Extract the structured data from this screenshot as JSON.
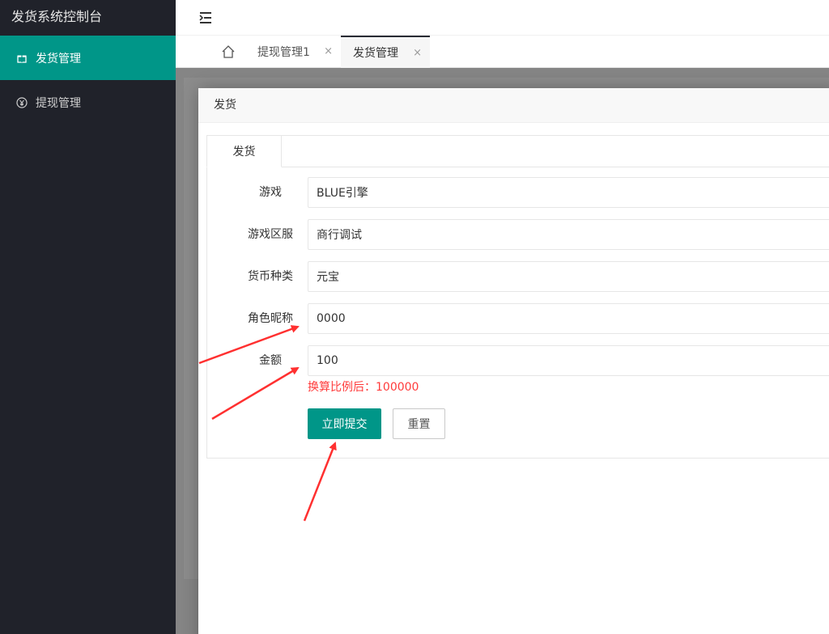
{
  "sidebar": {
    "title": "发货系统控制台",
    "items": [
      {
        "label": "发货管理",
        "icon": "gift-icon",
        "active": true
      },
      {
        "label": "提现管理",
        "icon": "yen-circle-icon",
        "active": false
      }
    ]
  },
  "header": {
    "menu_icon": "collapse-menu-icon"
  },
  "tabs": {
    "home_icon": "home-icon",
    "items": [
      {
        "label": "提现管理1",
        "active": false
      },
      {
        "label": "发货管理",
        "active": true
      }
    ],
    "close_glyph": "×"
  },
  "modal": {
    "title": "发货",
    "tab_label": "发货",
    "fields": [
      {
        "label": "游戏",
        "value": "BLUE引擎"
      },
      {
        "label": "游戏区服",
        "value": "商行调试"
      },
      {
        "label": "货币种类",
        "value": "元宝"
      },
      {
        "label": "角色昵称",
        "value": "0000"
      },
      {
        "label": "金额",
        "value": "100"
      }
    ],
    "hint": "换算比例后：100000",
    "submit_label": "立即提交",
    "reset_label": "重置"
  },
  "colors": {
    "accent": "#009688",
    "sidebar_bg": "#20222a",
    "hint": "#ff3b3b",
    "arrow": "#ff3030"
  }
}
